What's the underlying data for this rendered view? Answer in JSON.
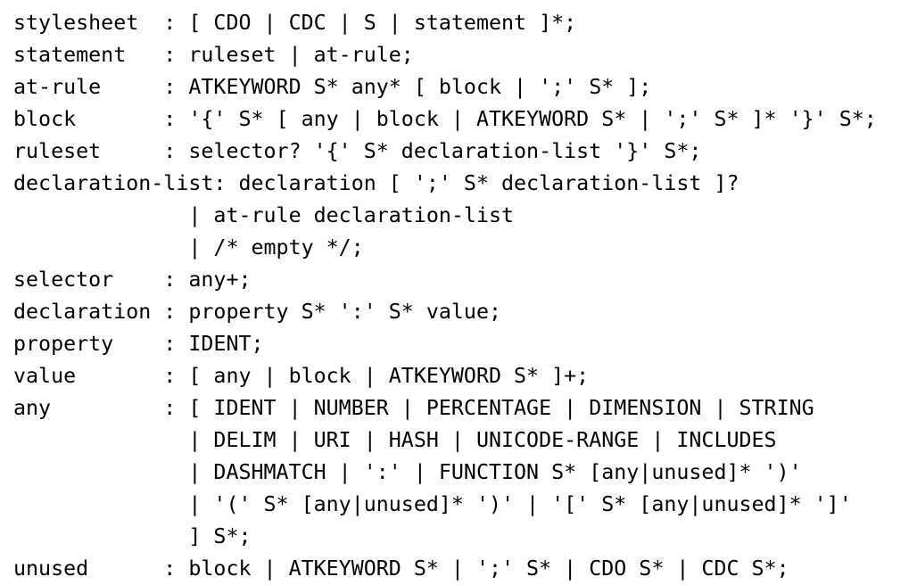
{
  "grammar": {
    "lines": [
      "stylesheet  : [ CDO | CDC | S | statement ]*;",
      "statement   : ruleset | at-rule;",
      "at-rule     : ATKEYWORD S* any* [ block | ';' S* ];",
      "block       : '{' S* [ any | block | ATKEYWORD S* | ';' S* ]* '}' S*;",
      "ruleset     : selector? '{' S* declaration-list '}' S*;",
      "declaration-list: declaration [ ';' S* declaration-list ]?",
      "              | at-rule declaration-list",
      "              | /* empty */;",
      "selector    : any+;",
      "declaration : property S* ':' S* value;",
      "property    : IDENT;",
      "value       : [ any | block | ATKEYWORD S* ]+;",
      "any         : [ IDENT | NUMBER | PERCENTAGE | DIMENSION | STRING",
      "              | DELIM | URI | HASH | UNICODE-RANGE | INCLUDES",
      "              | DASHMATCH | ':' | FUNCTION S* [any|unused]* ')'",
      "              | '(' S* [any|unused]* ')' | '[' S* [any|unused]* ']'",
      "              ] S*;",
      "unused      : block | ATKEYWORD S* | ';' S* | CDO S* | CDC S*;"
    ]
  }
}
